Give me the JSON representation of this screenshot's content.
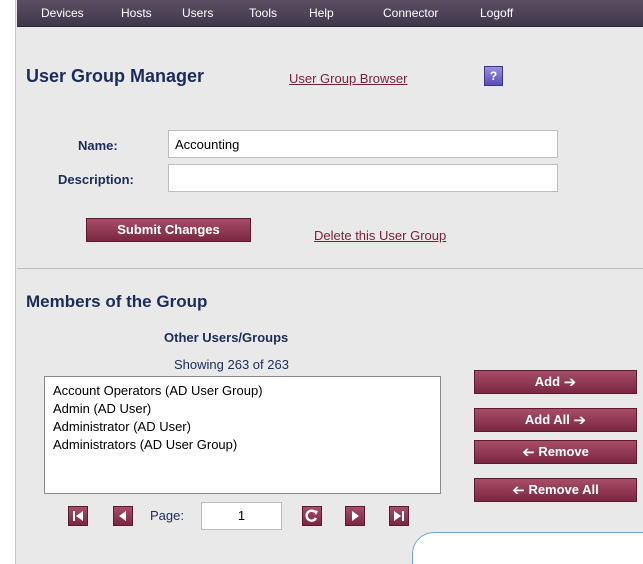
{
  "nav": {
    "items": [
      "Devices",
      "Hosts",
      "Users",
      "Tools",
      "Help",
      "Connector",
      "Logoff"
    ]
  },
  "header": {
    "title": "User Group Manager",
    "browser_link": "User Group Browser",
    "help_label": "?"
  },
  "form": {
    "name_label": "Name:",
    "name_value": "Accounting",
    "description_label": "Description:",
    "description_value": "",
    "submit_label": "Submit Changes",
    "delete_link": "Delete this User Group"
  },
  "members": {
    "title": "Members of the Group",
    "other_heading": "Other Users/Groups",
    "showing": "Showing 263 of 263",
    "items": [
      "Account Operators (AD User Group)",
      "Admin (AD User)",
      "Administrator (AD User)",
      "Administrators (AD User Group)"
    ],
    "buttons": {
      "add": "Add",
      "add_all": "Add All",
      "remove": "Remove",
      "remove_all": "Remove All"
    },
    "pager": {
      "page_label": "Page:",
      "page_value": "1"
    }
  },
  "colors": {
    "navbar": "#4a3f52",
    "accent": "#8b3550",
    "heading": "#1b2b5a"
  }
}
